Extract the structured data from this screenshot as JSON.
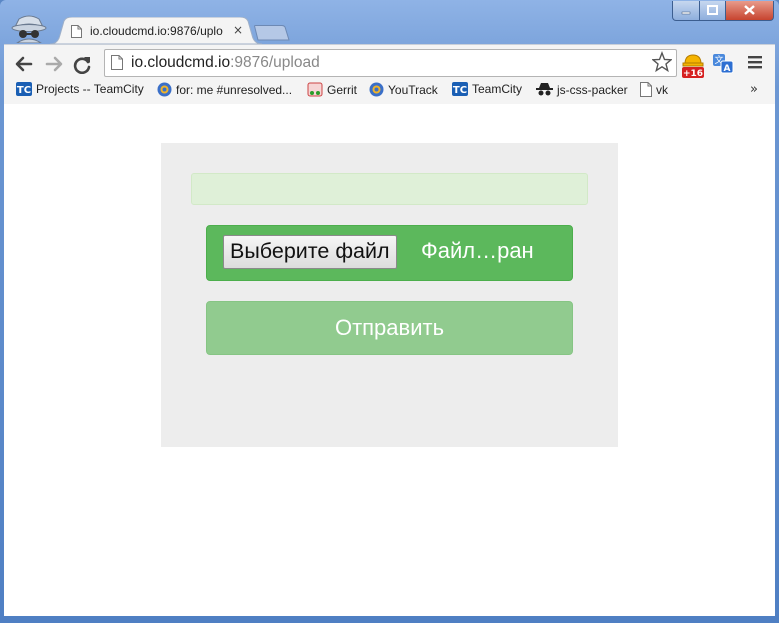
{
  "window": {
    "tab_title": "io.cloudcmd.io:9876/uplo",
    "tab_close": "×"
  },
  "omnibox": {
    "url_host": "io.cloudcmd.io",
    "url_rest": ":9876/upload"
  },
  "extensions": {
    "badge": "+16"
  },
  "bookmarks": [
    {
      "label": "Projects -- TeamCity",
      "icon": "teamcity-icon"
    },
    {
      "label": "for: me #unresolved...",
      "icon": "youtrack-icon"
    },
    {
      "label": "Gerrit",
      "icon": "gerrit-icon"
    },
    {
      "label": "YouTrack",
      "icon": "youtrack-icon"
    },
    {
      "label": "TeamCity",
      "icon": "teamcity-icon"
    },
    {
      "label": "js-css-packer",
      "icon": "spy-icon"
    },
    {
      "label": "vk",
      "icon": "page-icon"
    }
  ],
  "bookmarks_more": "»",
  "upload": {
    "progress": 0,
    "choose_file_label": "Выберите файл",
    "file_status": "Файл…ран",
    "submit_label": "Отправить"
  },
  "colors": {
    "success": "#5cb85c",
    "success_disabled": "#91cb8f",
    "progress_bg": "#dff0d8",
    "panel_bg": "#ededed"
  }
}
